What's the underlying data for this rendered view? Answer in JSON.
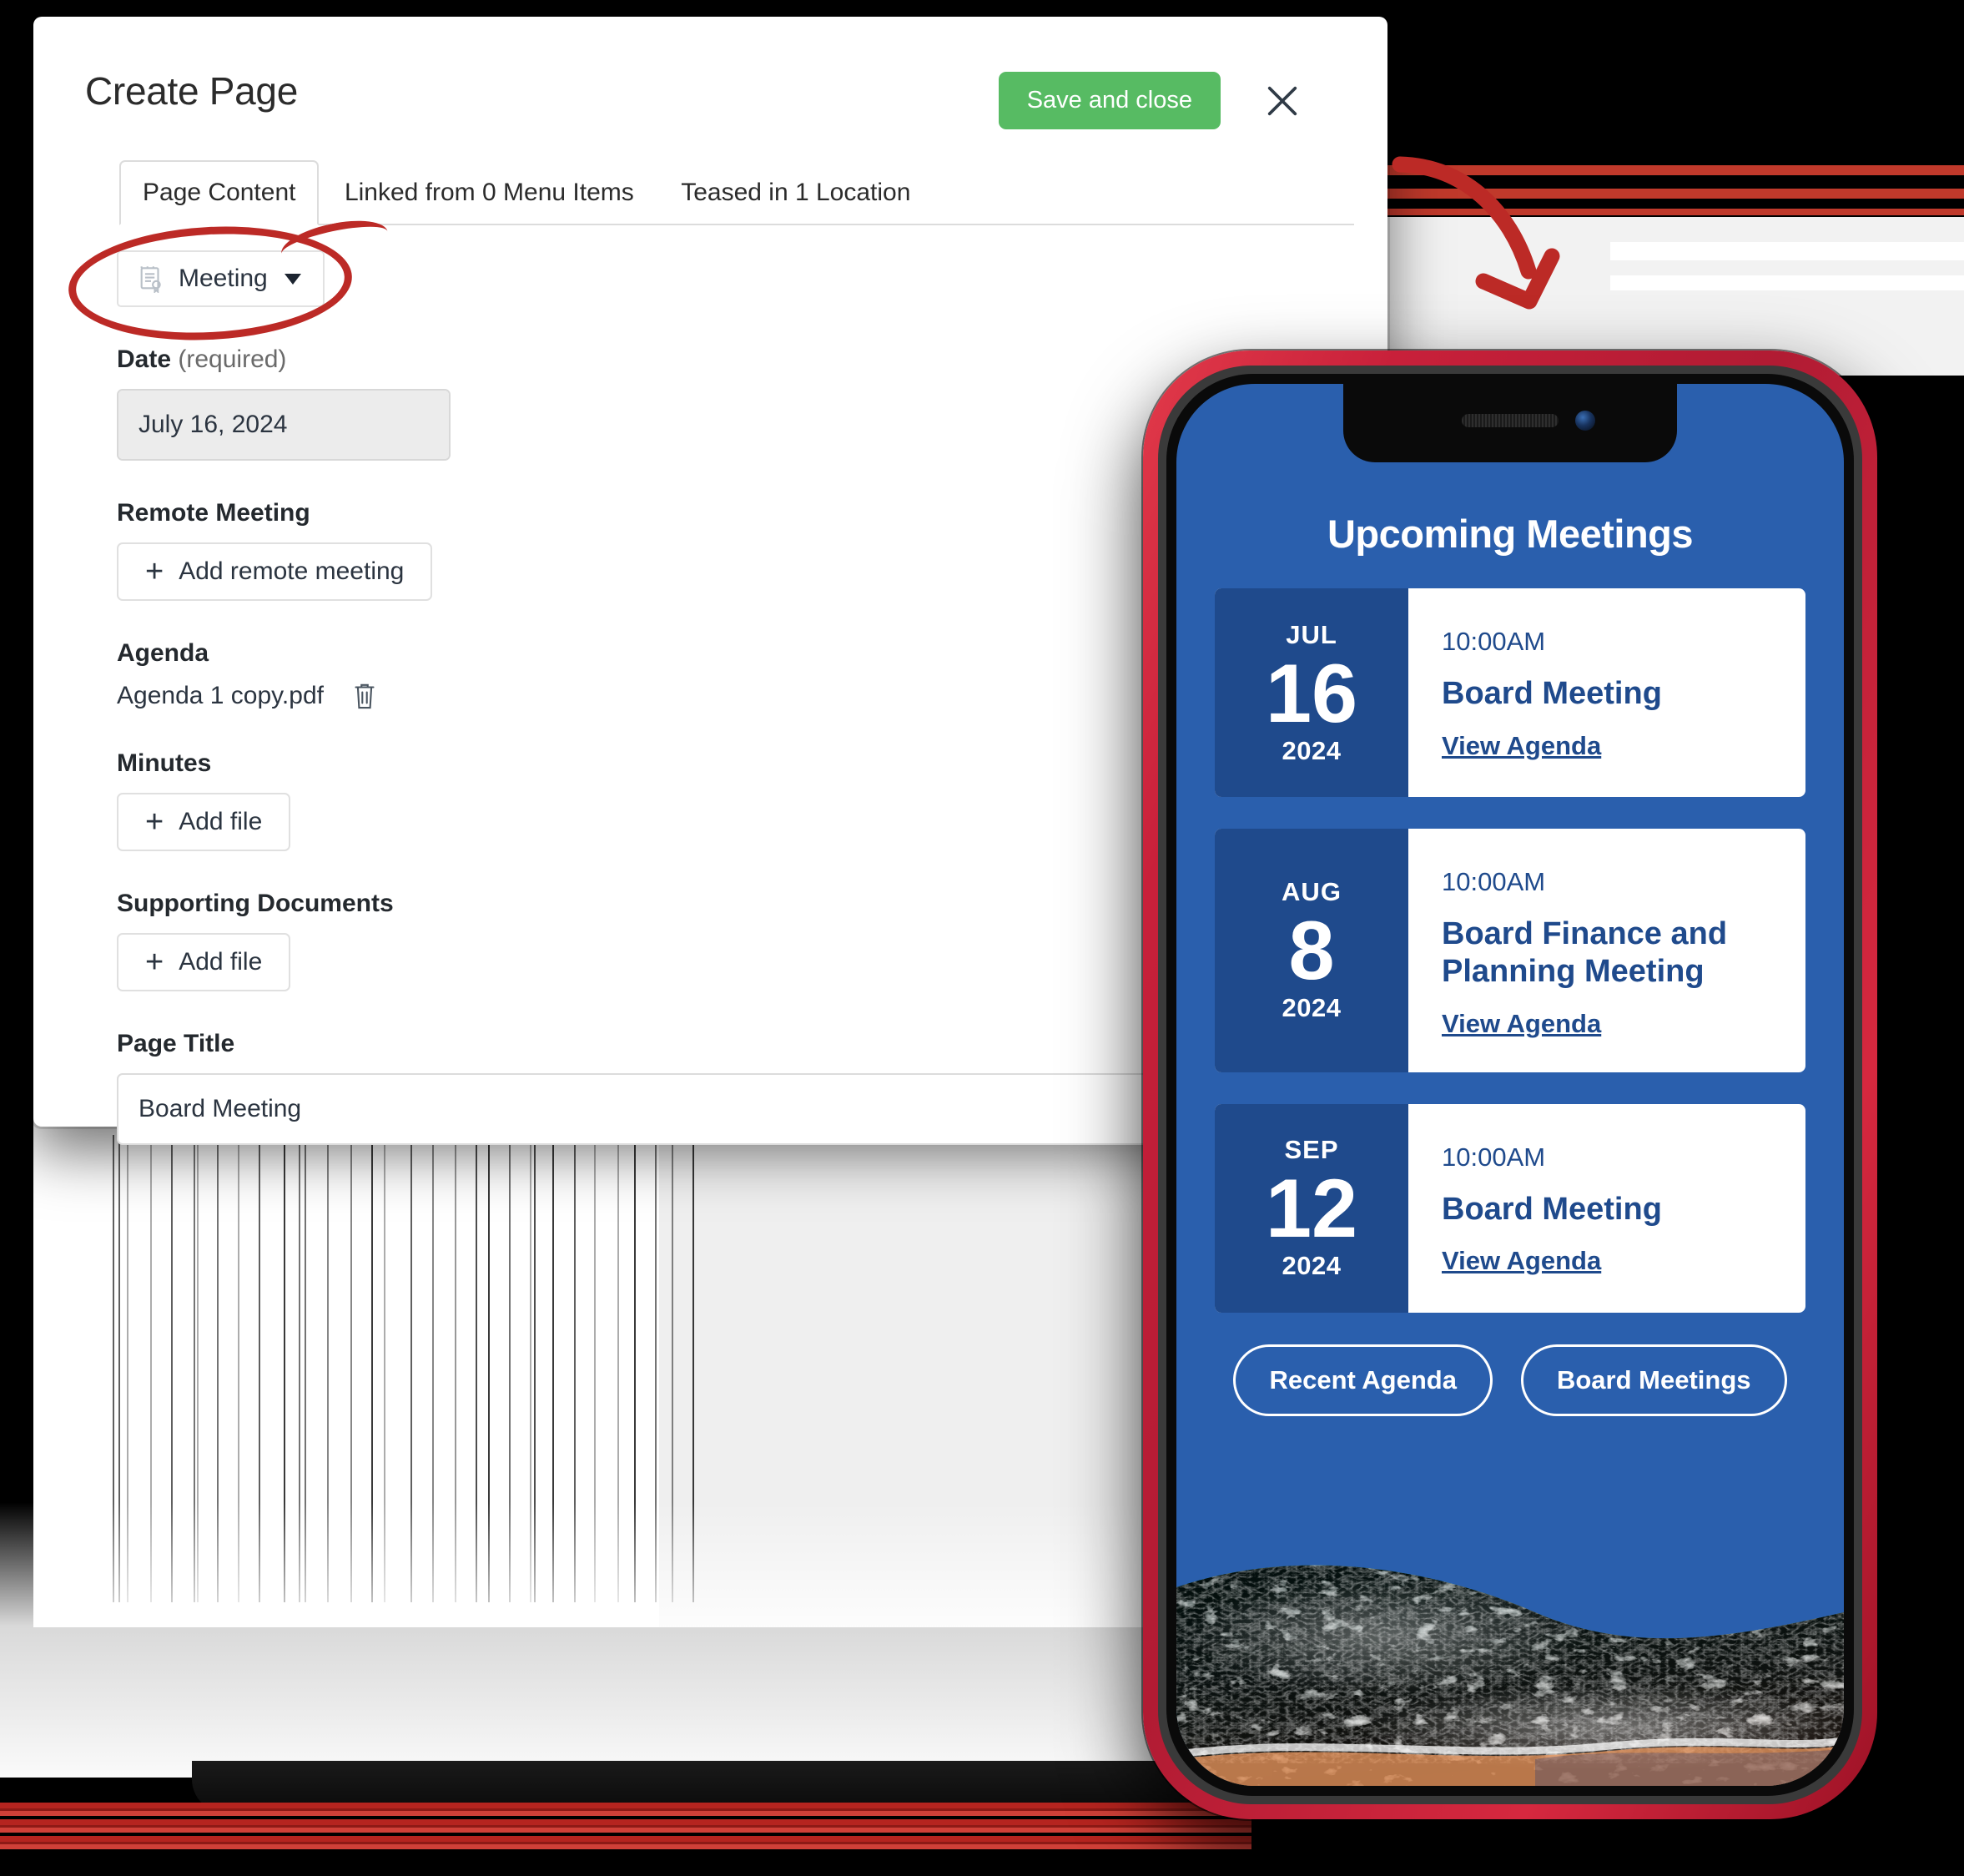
{
  "dialog": {
    "title": "Create Page",
    "save_label": "Save and close",
    "close_icon": "close-icon",
    "tabs": [
      {
        "label": "Page Content",
        "active": true
      },
      {
        "label": "Linked from 0 Menu Items",
        "active": false
      },
      {
        "label": "Teased in 1 Location",
        "active": false
      }
    ],
    "content_type": {
      "label": "Meeting",
      "icon": "document-meeting-icon",
      "caret": "chevron-down-icon"
    },
    "fields": {
      "date": {
        "label": "Date",
        "required_suffix": "(required)",
        "value": "July 16, 2024",
        "calendar_icon": "calendar-icon"
      },
      "remote_meeting": {
        "label": "Remote Meeting",
        "add_label": "Add remote meeting"
      },
      "agenda": {
        "label": "Agenda",
        "file_name": "Agenda 1 copy.pdf",
        "delete_icon": "trash-icon"
      },
      "minutes": {
        "label": "Minutes",
        "add_label": "Add file"
      },
      "supporting_documents": {
        "label": "Supporting Documents",
        "add_label": "Add file"
      },
      "page_title": {
        "label": "Page Title",
        "value": "Board Meeting",
        "placeholder": "Page Title"
      }
    }
  },
  "annotations": {
    "circle": "red-ellipse-highlight",
    "arrow": "red-curved-arrow"
  },
  "phone": {
    "screen": {
      "heading": "Upcoming Meetings",
      "meetings": [
        {
          "month": "JUL",
          "day": "16",
          "year": "2024",
          "time": "10:00AM",
          "title": "Board Meeting",
          "link": "View Agenda"
        },
        {
          "month": "AUG",
          "day": "8",
          "year": "2024",
          "time": "10:00AM",
          "title": "Board Finance and Planning Meeting",
          "link": "View Agenda"
        },
        {
          "month": "SEP",
          "day": "12",
          "year": "2024",
          "time": "10:00AM",
          "title": "Board Meeting",
          "link": "View Agenda"
        }
      ],
      "pills": [
        {
          "label": "Recent Agenda"
        },
        {
          "label": "Board Meetings"
        }
      ],
      "footer_image": "ocean-beach-photo"
    }
  },
  "colors": {
    "save_green": "#57bb63",
    "annotation_red": "#bc2a26",
    "screen_blue": "#2a5fad",
    "date_block_navy": "#1f4a8c",
    "phone_frame_red": "#c8203a"
  }
}
